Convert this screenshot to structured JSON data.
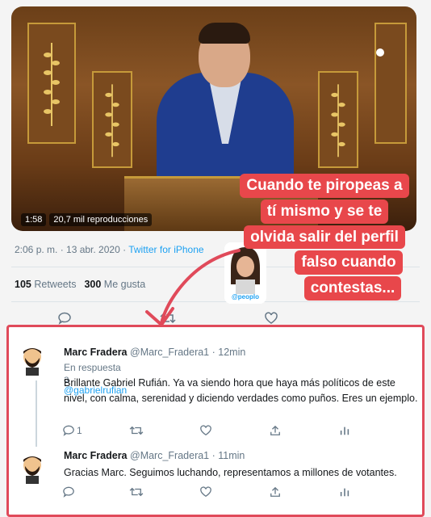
{
  "video": {
    "duration": "1:58",
    "views": "20,7 mil reproducciones"
  },
  "tweet": {
    "timestamp": "2:06 p. m. · 13 abr. 2020 · ",
    "source": "Twitter for iPhone",
    "retweets_count": "105",
    "retweets_label": "Retweets",
    "likes_count": "300",
    "likes_label": "Me gusta"
  },
  "caption": {
    "lines": [
      "Cuando te piropeas a",
      "tí mismo y se te",
      "olvida salir del perfil",
      "falso cuando",
      "contestas..."
    ]
  },
  "sticker": {
    "label": "@peoplo"
  },
  "replies": [
    {
      "name": "Marc Fradera",
      "handle": "@Marc_Fradera1 · 12min",
      "in_reply_prefix": "En respuesta a ",
      "in_reply_to": "@gabrielrufian",
      "text": "Brillante Gabriel Rufián. Ya va siendo hora que haya más políticos de este nivel, con calma, serenidad y diciendo verdades como puños. Eres un ejemplo.",
      "reply_count": "1"
    },
    {
      "name": "Marc Fradera",
      "handle": "@Marc_Fradera1 · 11min",
      "text": "Gracias Marc. Seguimos luchando, representamos a millones de votantes."
    }
  ],
  "colors": {
    "accent": "#1da1f2",
    "caption_bg": "#e8474b",
    "annotation": "#e04a5a"
  }
}
